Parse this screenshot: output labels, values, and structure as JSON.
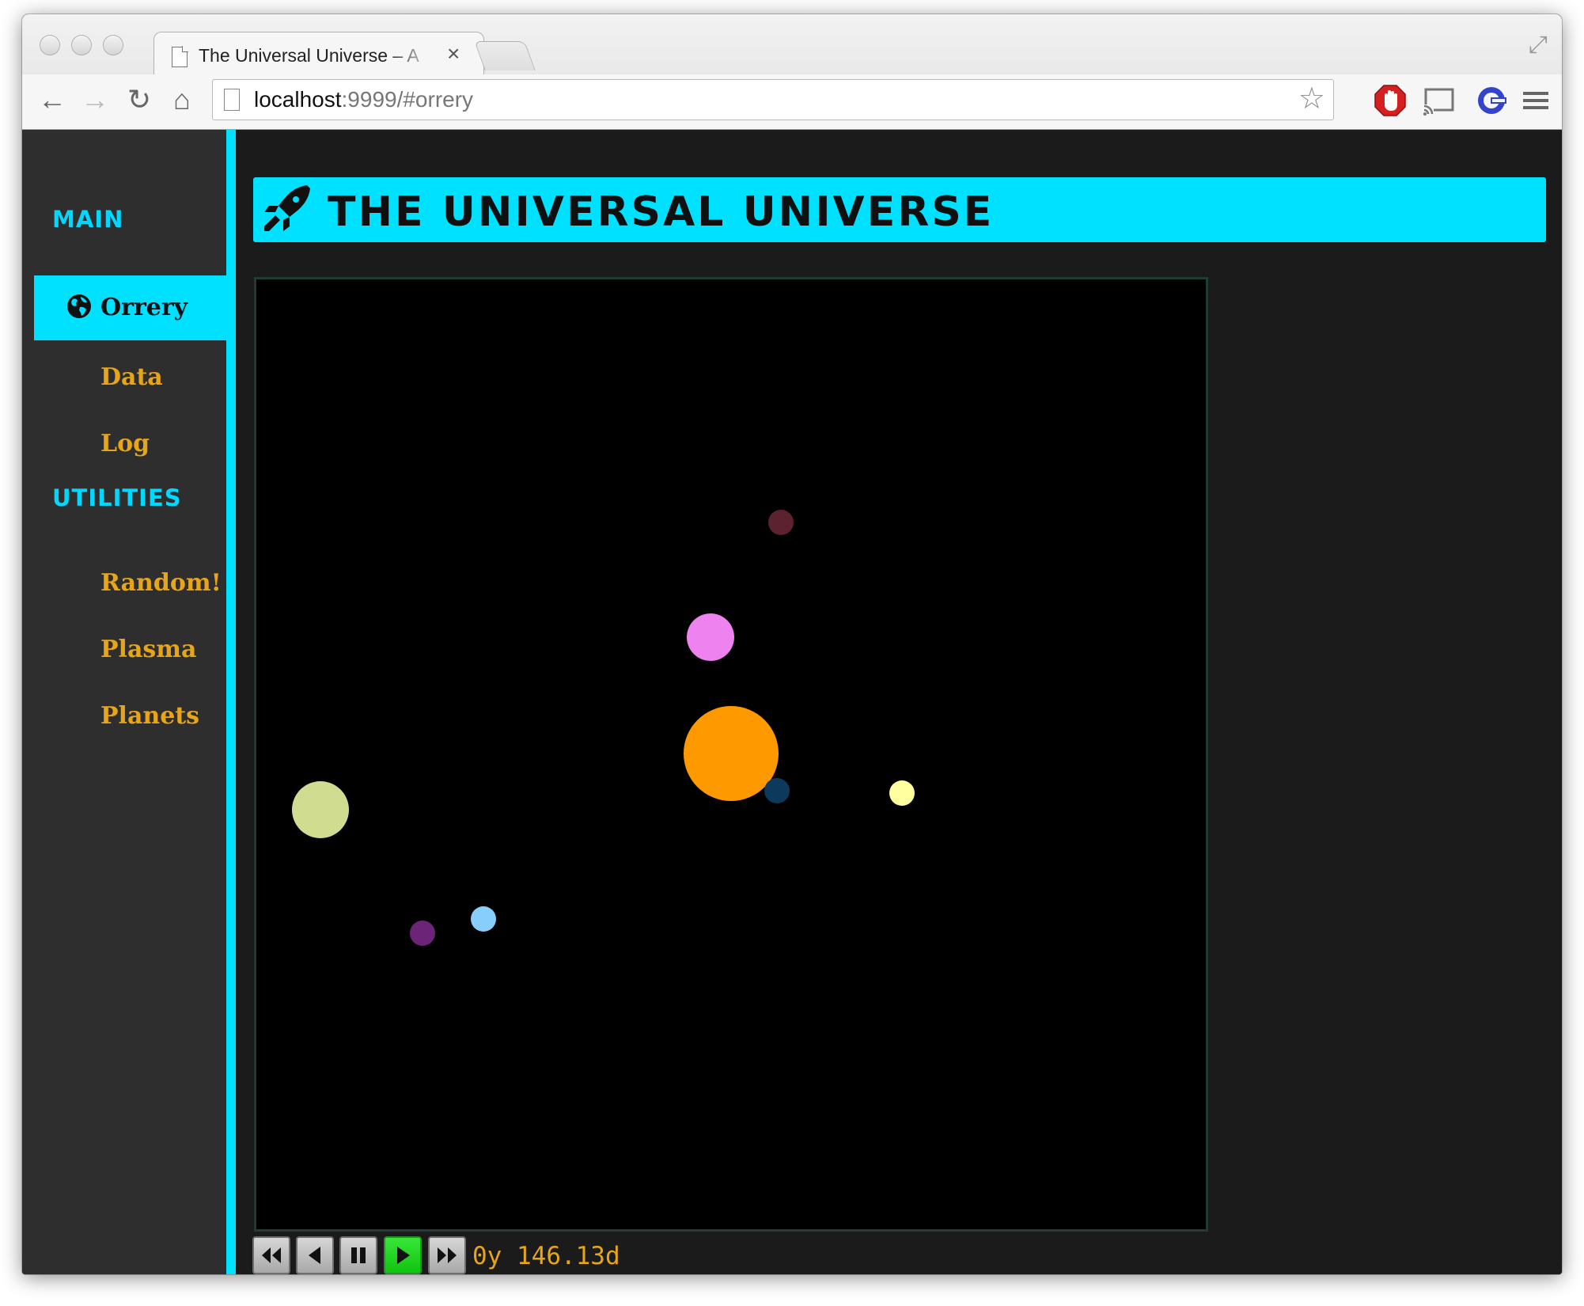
{
  "browser": {
    "tab_title": "The Universal Universe – A",
    "tab_close": "×",
    "url_host": "localhost",
    "url_rest": ":9999/#orrery",
    "back_icon": "←",
    "forward_icon": "→",
    "reload_icon": "↻",
    "home_icon": "⌂",
    "star_icon": "☆"
  },
  "sidebar": {
    "sections": [
      {
        "heading": "Main",
        "items": [
          {
            "label": "Orrery",
            "active": true,
            "icon": "globe-icon"
          },
          {
            "label": "Data",
            "active": false
          },
          {
            "label": "Log",
            "active": false
          }
        ]
      },
      {
        "heading": "Utilities",
        "items": [
          {
            "label": "Random!",
            "active": false
          },
          {
            "label": "Plasma",
            "active": false
          },
          {
            "label": "Planets",
            "active": false
          }
        ]
      }
    ]
  },
  "header": {
    "title": "The Universal Universe",
    "icon": "rocket-icon"
  },
  "orrery": {
    "background": "#000000",
    "bodies": [
      {
        "name": "sun",
        "color": "#ff9900"
      },
      {
        "name": "planet-1",
        "color": "#ee82ee"
      },
      {
        "name": "planet-2",
        "color": "#5c2230"
      },
      {
        "name": "planet-3",
        "color": "#0d3a5c"
      },
      {
        "name": "planet-4",
        "color": "#ffffa0"
      },
      {
        "name": "planet-5",
        "color": "#d0dd90"
      },
      {
        "name": "planet-6",
        "color": "#87cefa"
      },
      {
        "name": "planet-7",
        "color": "#6b2478"
      }
    ]
  },
  "controls": {
    "buttons": [
      "rewind-icon",
      "step-back-icon",
      "pause-icon",
      "play-icon",
      "fast-forward-icon"
    ],
    "active_button": "play-icon",
    "time": "0y 146.13d"
  },
  "colors": {
    "accent": "#00e0ff",
    "nav_text": "#e7a51a",
    "sidebar_bg": "#2e2e2e",
    "page_bg": "#1b1b1b"
  }
}
